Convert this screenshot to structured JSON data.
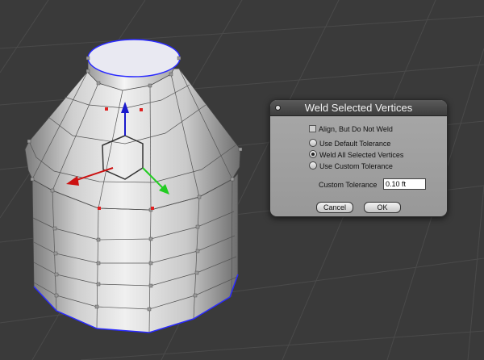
{
  "dialog": {
    "title": "Weld Selected Vertices",
    "options": {
      "align_checkbox": "Align, But Do Not Weld",
      "default_tol": "Use Default Tolerance",
      "weld_all": "Weld All Selected Vertices",
      "custom_tol": "Use Custom Tolerance"
    },
    "selected_option": "weld_all",
    "custom_tolerance_label": "Custom Tolerance",
    "custom_tolerance_value": "0.10 ft",
    "cancel_label": "Cancel",
    "ok_label": "OK"
  },
  "viewport": {
    "gizmo_colors": {
      "x": "#cc1111",
      "y": "#22cc22",
      "z": "#1a1acc"
    },
    "selection_color": "#2a2aff",
    "selected_vertex_color": "#e02020"
  }
}
